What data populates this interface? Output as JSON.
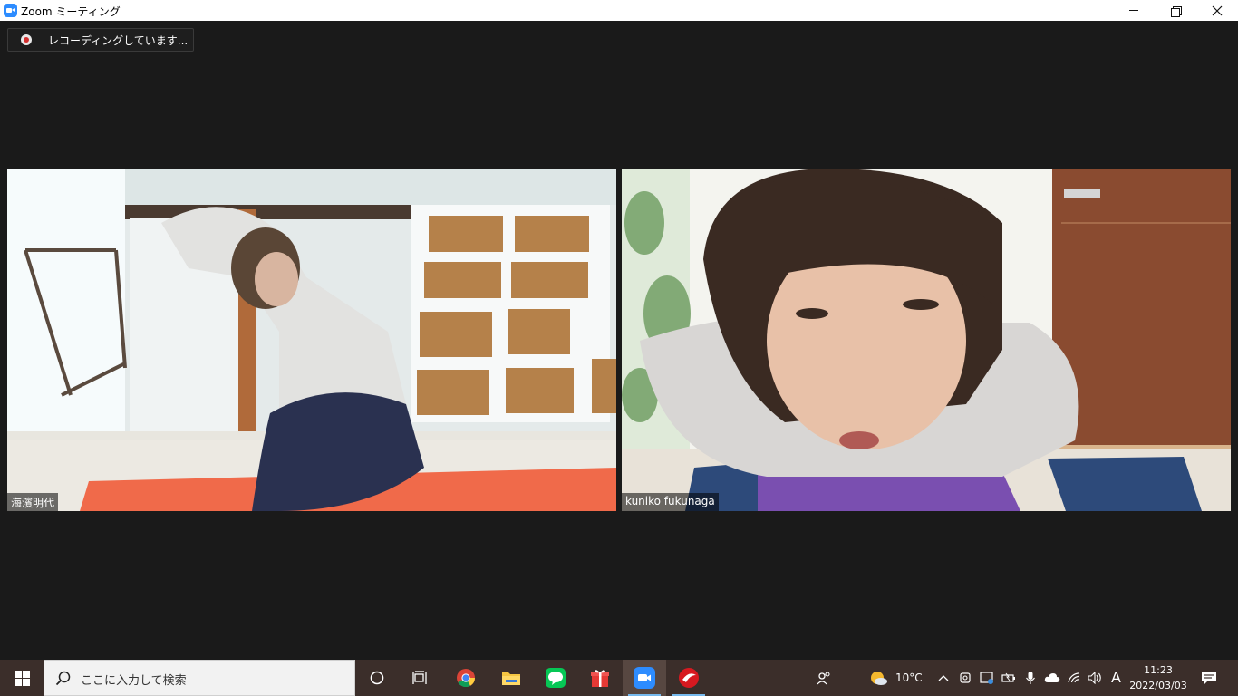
{
  "window": {
    "title": "Zoom ミーティング",
    "icon": "zoom-app-icon",
    "controls": [
      "minimize",
      "maximize",
      "close"
    ]
  },
  "recording": {
    "label": "レコーディングしています..."
  },
  "participants": [
    {
      "name": "海濱明代"
    },
    {
      "name": "kuniko fukunaga"
    }
  ],
  "taskbar": {
    "search_placeholder": "ここに入力して検索",
    "pinned_apps": [
      "cortana",
      "task-view",
      "chrome",
      "file-explorer",
      "line",
      "gift",
      "zoom",
      "trend-micro"
    ],
    "weather": {
      "temperature": "10°C"
    },
    "ime_indicator": "A",
    "clock": {
      "time": "11:23",
      "date": "2022/03/03"
    }
  },
  "colors": {
    "window_background": "#1a1a1a",
    "taskbar_background": "#3b2e2a",
    "zoom_blue": "#2d8cff",
    "recording_red": "#d32f2f"
  }
}
